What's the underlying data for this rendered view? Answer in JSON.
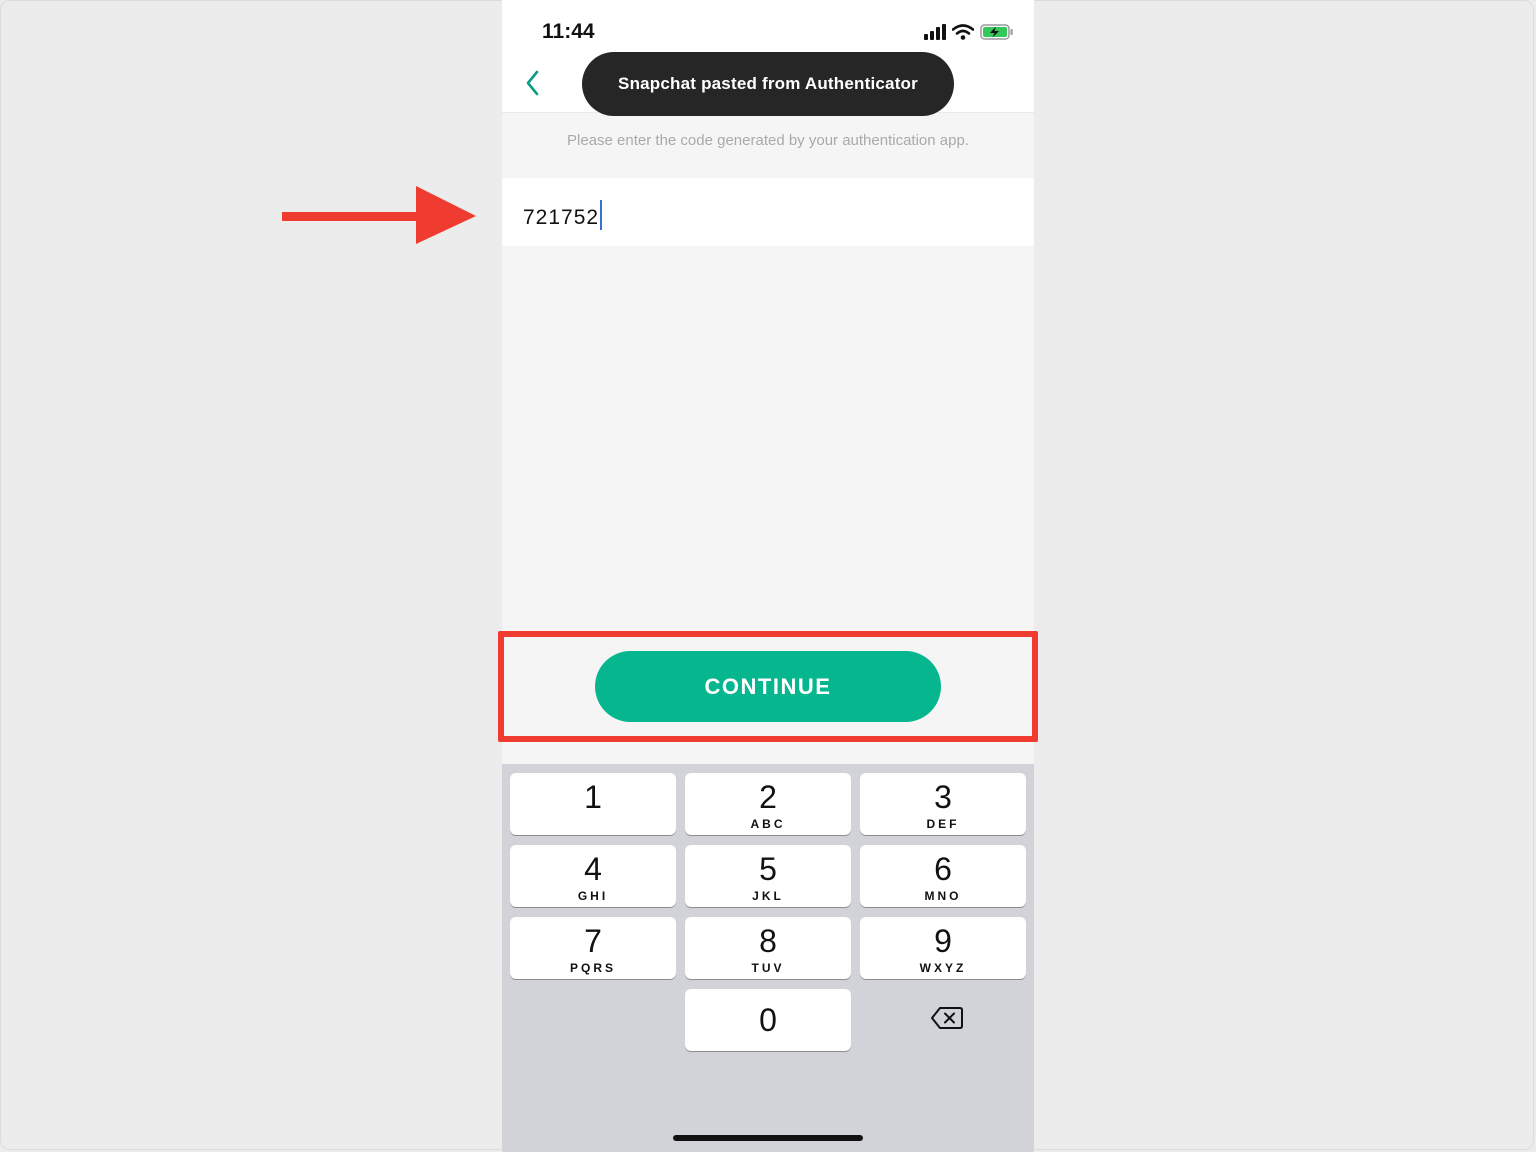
{
  "status_bar": {
    "time": "11:44"
  },
  "toast": {
    "text": "Snapchat pasted from Authenticator"
  },
  "instruction": "Please enter the code generated by your authentication app.",
  "code_field": {
    "value": "721752"
  },
  "continue_button": {
    "label": "CONTINUE"
  },
  "keypad": {
    "keys": [
      {
        "digit": "1",
        "letters": ""
      },
      {
        "digit": "2",
        "letters": "ABC"
      },
      {
        "digit": "3",
        "letters": "DEF"
      },
      {
        "digit": "4",
        "letters": "GHI"
      },
      {
        "digit": "5",
        "letters": "JKL"
      },
      {
        "digit": "6",
        "letters": "MNO"
      },
      {
        "digit": "7",
        "letters": "PQRS"
      },
      {
        "digit": "8",
        "letters": "TUV"
      },
      {
        "digit": "9",
        "letters": "WXYZ"
      },
      {
        "digit": "0",
        "letters": ""
      }
    ]
  },
  "colors": {
    "accent": "#06b68f",
    "annotation": "#f03c30",
    "toast_bg": "#262626",
    "battery": "#34c759"
  },
  "icons": {
    "back": "chevron-left-icon",
    "signal": "signal-icon",
    "wifi": "wifi-icon",
    "battery": "battery-charging-icon",
    "delete": "backspace-icon",
    "annotation_arrow": "arrow-right-icon"
  }
}
